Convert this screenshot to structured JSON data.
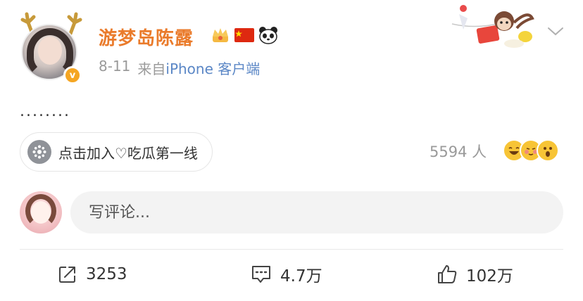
{
  "post": {
    "author": {
      "name": "游梦岛陈露",
      "badges": [
        "crown-badge",
        "china-flag-badge",
        "panda-badge"
      ],
      "verified": true,
      "verified_icon": "v"
    },
    "meta": {
      "date": "8-11",
      "from_prefix": "来自",
      "source": "iPhone 客户端"
    },
    "content": "........",
    "topic": {
      "icon": "topic-icon",
      "label": "点击加入♡吃瓜第一线"
    },
    "viewers": {
      "count_label": "5594 人",
      "reactions": [
        "laugh",
        "blush",
        "surprise"
      ]
    }
  },
  "comment_box": {
    "placeholder": "写评论..."
  },
  "actions": {
    "repost": {
      "icon": "repost-icon",
      "count": "3253"
    },
    "comment": {
      "icon": "comment-icon",
      "count": "4.7万"
    },
    "like": {
      "icon": "like-icon",
      "count": "102万"
    }
  },
  "colors": {
    "author_name": "#ea7b2b",
    "source_link": "#5b87c6",
    "meta_gray": "#9a9a9a",
    "input_bg": "#f3f3f3"
  }
}
